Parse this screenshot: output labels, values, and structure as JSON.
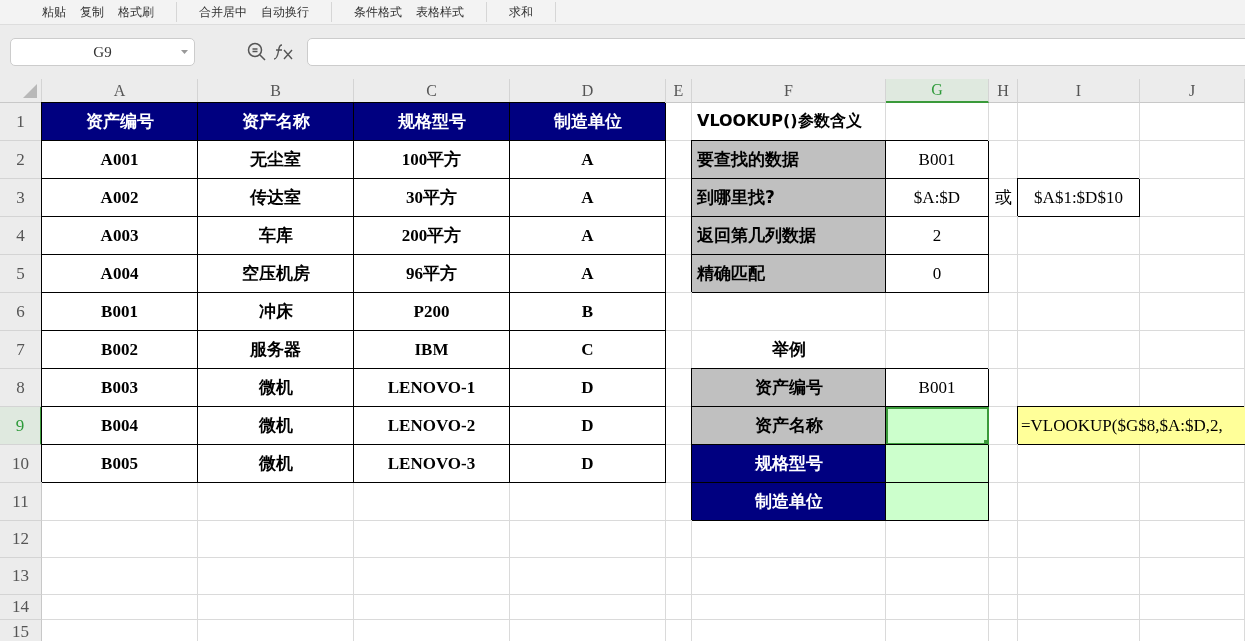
{
  "toolbar": {
    "groups": [
      {
        "buttons": [
          "粘贴",
          "复制",
          "格式刷"
        ]
      },
      {
        "buttons": [
          "合并居中",
          "自动换行"
        ]
      },
      {
        "buttons": [
          "条件格式",
          "表格样式"
        ]
      },
      {
        "buttons": [
          "求和"
        ]
      }
    ]
  },
  "formula_bar": {
    "name_box": "G9"
  },
  "columns": [
    {
      "label": "A",
      "selected": false
    },
    {
      "label": "B",
      "selected": false
    },
    {
      "label": "C",
      "selected": false
    },
    {
      "label": "D",
      "selected": false
    },
    {
      "label": "E",
      "selected": false
    },
    {
      "label": "F",
      "selected": false
    },
    {
      "label": "G",
      "selected": true
    },
    {
      "label": "H",
      "selected": false
    },
    {
      "label": "I",
      "selected": false
    },
    {
      "label": "J",
      "selected": false
    }
  ],
  "rows": [
    {
      "label": "1",
      "selected": false,
      "cells": [
        {
          "kind": "header",
          "text": "资产编号"
        },
        {
          "kind": "header",
          "text": "资产名称"
        },
        {
          "kind": "header",
          "text": "规格型号"
        },
        {
          "kind": "header",
          "text": "制造单位"
        },
        {
          "kind": "blank"
        },
        {
          "kind": "title",
          "text": "VLOOKUP()参数含义"
        }
      ]
    },
    {
      "label": "2",
      "selected": false,
      "cells": [
        {
          "kind": "data",
          "text": "A001"
        },
        {
          "kind": "data",
          "text": "无尘室"
        },
        {
          "kind": "data",
          "text": "100平方"
        },
        {
          "kind": "data",
          "text": "A"
        },
        {
          "kind": "blank"
        },
        {
          "kind": "label",
          "text": "要查找的数据"
        },
        {
          "kind": "value",
          "text": "B001"
        }
      ]
    },
    {
      "label": "3",
      "selected": false,
      "cells": [
        {
          "kind": "data",
          "text": "A002"
        },
        {
          "kind": "data",
          "text": "传达室"
        },
        {
          "kind": "data",
          "text": "30平方"
        },
        {
          "kind": "data",
          "text": "A"
        },
        {
          "kind": "blank"
        },
        {
          "kind": "label",
          "text": "到哪里找?"
        },
        {
          "kind": "value",
          "text": "$A:$D"
        },
        {
          "kind": "plain",
          "text": "或"
        },
        {
          "kind": "value",
          "text": "$A$1:$D$10"
        }
      ]
    },
    {
      "label": "4",
      "selected": false,
      "cells": [
        {
          "kind": "data",
          "text": "A003"
        },
        {
          "kind": "data",
          "text": "车库"
        },
        {
          "kind": "data",
          "text": "200平方"
        },
        {
          "kind": "data",
          "text": "A"
        },
        {
          "kind": "blank"
        },
        {
          "kind": "label",
          "text": "返回第几列数据"
        },
        {
          "kind": "value",
          "text": "2"
        }
      ]
    },
    {
      "label": "5",
      "selected": false,
      "cells": [
        {
          "kind": "data",
          "text": "A004"
        },
        {
          "kind": "data",
          "text": "空压机房"
        },
        {
          "kind": "data",
          "text": "96平方"
        },
        {
          "kind": "data",
          "text": "A"
        },
        {
          "kind": "blank"
        },
        {
          "kind": "label",
          "text": "精确匹配"
        },
        {
          "kind": "value",
          "text": "0"
        }
      ]
    },
    {
      "label": "6",
      "selected": false,
      "cells": [
        {
          "kind": "data",
          "text": "B001"
        },
        {
          "kind": "data",
          "text": "冲床"
        },
        {
          "kind": "data",
          "text": "P200"
        },
        {
          "kind": "data",
          "text": "B"
        }
      ]
    },
    {
      "label": "7",
      "selected": false,
      "cells": [
        {
          "kind": "data",
          "text": "B002"
        },
        {
          "kind": "data",
          "text": "服务器"
        },
        {
          "kind": "data",
          "text": "IBM"
        },
        {
          "kind": "data",
          "text": "C"
        },
        {
          "kind": "blank"
        },
        {
          "kind": "caption",
          "text": "举例"
        }
      ]
    },
    {
      "label": "8",
      "selected": false,
      "cells": [
        {
          "kind": "data",
          "text": "B003"
        },
        {
          "kind": "data",
          "text": "微机"
        },
        {
          "kind": "data",
          "text": "LENOVO-1"
        },
        {
          "kind": "data",
          "text": "D"
        },
        {
          "kind": "blank"
        },
        {
          "kind": "label-center",
          "text": "资产编号"
        },
        {
          "kind": "value",
          "text": "B001"
        }
      ]
    },
    {
      "label": "9",
      "selected": true,
      "cells": [
        {
          "kind": "data",
          "text": "B004"
        },
        {
          "kind": "data",
          "text": "微机"
        },
        {
          "kind": "data",
          "text": "LENOVO-2"
        },
        {
          "kind": "data",
          "text": "D"
        },
        {
          "kind": "blank"
        },
        {
          "kind": "label-center",
          "text": "资产名称"
        },
        {
          "kind": "result",
          "selected": true
        },
        {
          "kind": "blank"
        },
        {
          "kind": "note",
          "text": "=VLOOKUP($G$8,$A:$D,2,"
        }
      ]
    },
    {
      "label": "10",
      "selected": false,
      "cells": [
        {
          "kind": "data",
          "text": "B005"
        },
        {
          "kind": "data",
          "text": "微机"
        },
        {
          "kind": "data",
          "text": "LENOVO-3"
        },
        {
          "kind": "data",
          "text": "D"
        },
        {
          "kind": "blank"
        },
        {
          "kind": "header",
          "text": "规格型号"
        },
        {
          "kind": "result",
          "selected": false
        }
      ]
    },
    {
      "label": "11",
      "selected": false,
      "cells": [
        {
          "kind": "blank"
        },
        {
          "kind": "blank"
        },
        {
          "kind": "blank"
        },
        {
          "kind": "blank"
        },
        {
          "kind": "blank"
        },
        {
          "kind": "header",
          "text": "制造单位"
        },
        {
          "kind": "result",
          "selected": false
        }
      ]
    },
    {
      "label": "12",
      "selected": false
    },
    {
      "label": "13",
      "selected": false
    },
    {
      "label": "14",
      "selected": false
    },
    {
      "label": "15",
      "selected": false
    }
  ]
}
